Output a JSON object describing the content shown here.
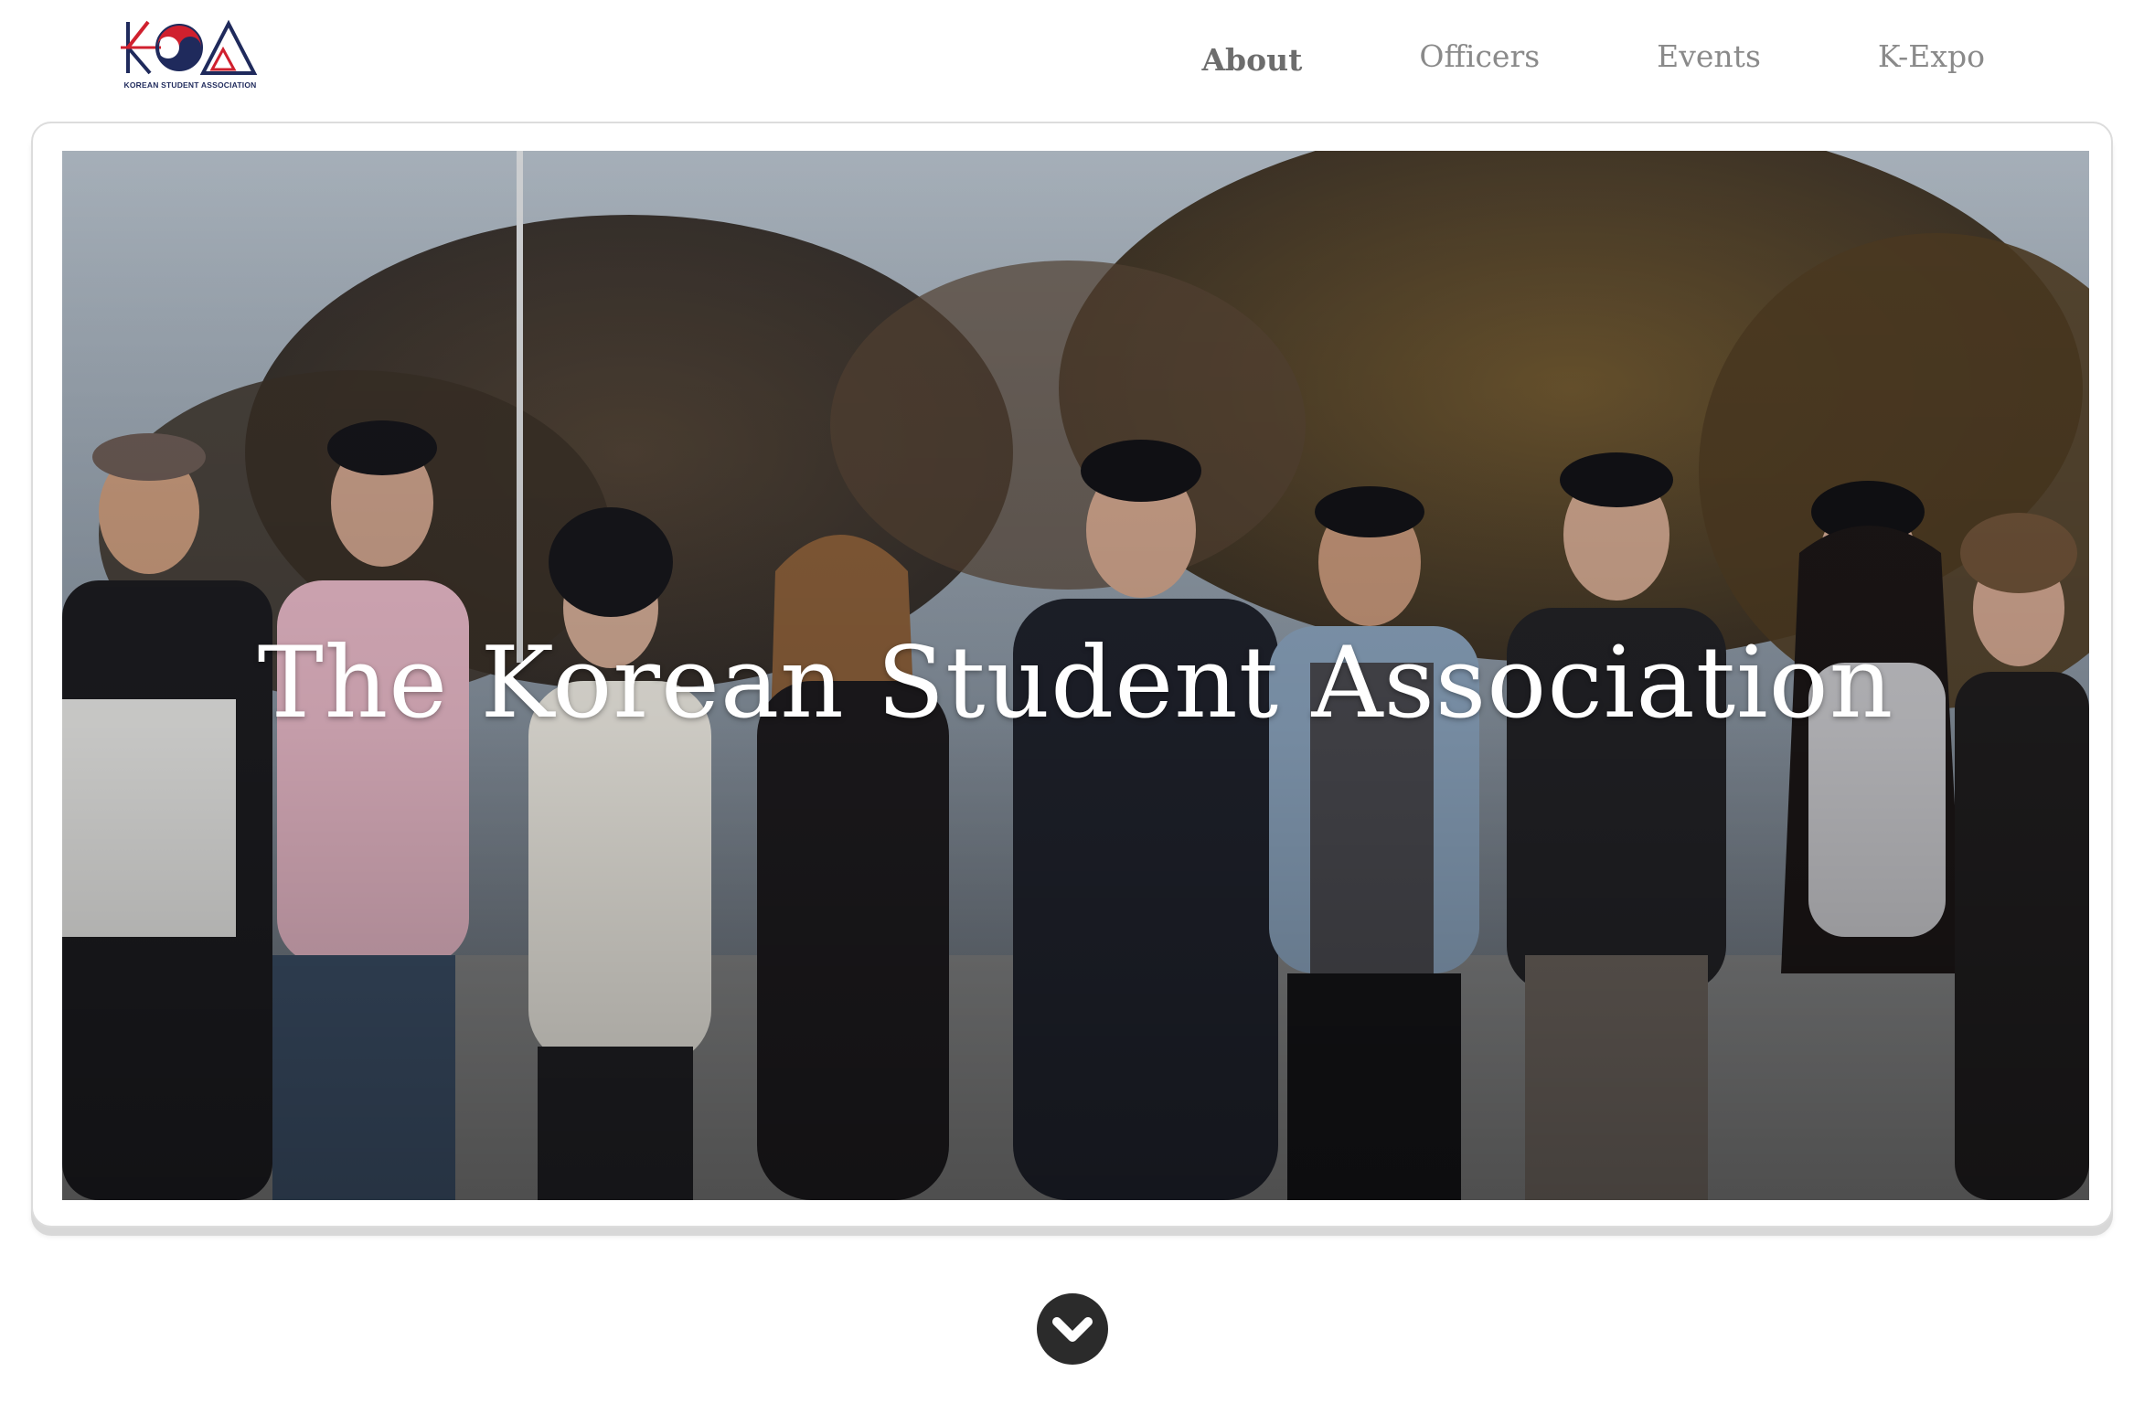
{
  "header": {
    "logo": {
      "monogram": "KSA",
      "caption": "KOREAN STUDENT ASSOCIATION",
      "colors": {
        "navy": "#1f2a5c",
        "red": "#d0202e"
      }
    },
    "nav": [
      {
        "label": "About",
        "active": true
      },
      {
        "label": "Officers",
        "active": false
      },
      {
        "label": "Events",
        "active": false
      },
      {
        "label": "K-Expo",
        "active": false
      }
    ]
  },
  "hero": {
    "title": "The Korean Student Association",
    "image": "group-photo-of-nine-students-outdoors-in-front-of-autumn-trees"
  },
  "scroll": {
    "icon": "chevron-down-icon"
  },
  "colors": {
    "nav_text": "#8a8a8a",
    "nav_active": "#6d6d6d",
    "hero_text": "#ffffff",
    "scroll_button": "#2b2b2b"
  }
}
